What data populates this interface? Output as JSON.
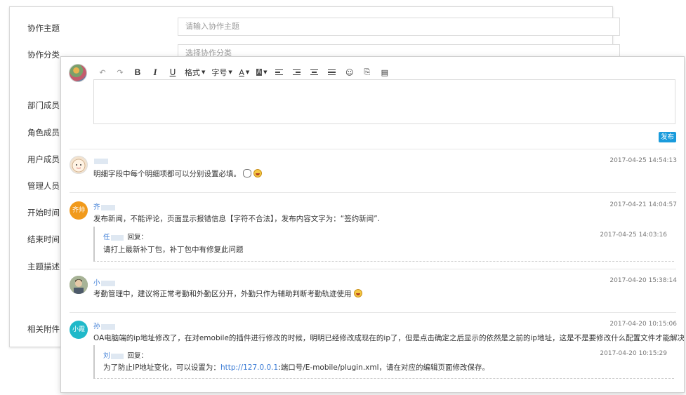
{
  "form": {
    "labels": [
      "协作主题",
      "协作分类",
      "部门成员",
      "角色成员",
      "用户成员",
      "管理人员",
      "开始时间",
      "结束时间",
      "主题描述",
      "相关附件"
    ],
    "subject_placeholder": "请输入协作主题",
    "category_placeholder": "选择协作分类"
  },
  "toolbar": {
    "format_label": "格式",
    "fontsize_label": "字号",
    "font_color_label": "A",
    "bg_color_label": "A",
    "bold_label": "B",
    "italic_label": "I",
    "underline_label": "U"
  },
  "composer": {
    "publish_label": "发布"
  },
  "comments": [
    {
      "name": "",
      "avatar_text": "",
      "avatar_color": "#f3e3cf",
      "time": "2017-04-25 14:54:13",
      "text": "明细字段中每个明细项都可以分别设置必填。",
      "emojis": [
        "chat-bubble",
        "grinning-face"
      ],
      "reply": null
    },
    {
      "name": "齐",
      "avatar_text": "齐帅",
      "avatar_color": "#f19a1c",
      "time": "2017-04-21 14:04:57",
      "text": "发布新闻，不能评论，页面显示报错信息【字符不合法】，发布内容文字为：“签约新闻”.",
      "emojis": [],
      "reply": {
        "name": "任",
        "label": "回复：",
        "time": "2017-04-25 14:03:16",
        "text": "请打上最新补丁包，补丁包中有修复此问题"
      }
    },
    {
      "name": "小",
      "avatar_text": "",
      "avatar_color": "#8a9a7a",
      "time": "2017-04-20 15:38:14",
      "text": "考勤管理中，建议将正常考勤和外勤区分开，外勤只作为辅助判断考勤轨迹使用",
      "emojis": [
        "grinning-face"
      ],
      "reply": null
    },
    {
      "name": "孙",
      "avatar_text": "小霞",
      "avatar_color": "#20b9c9",
      "time": "2017-04-20 10:15:06",
      "text": "OA电脑端的ip地址修改了，在对emobile的插件进行修改的时候，明明已经修改成现在的ip了，但是点击确定之后显示的依然是之前的ip地址，这是不是要修改什么配置文件才能解决。",
      "emojis": [],
      "reply": {
        "name": "刘",
        "label": "回复：",
        "time": "2017-04-20 10:15:29",
        "text_prefix": "为了防止IP地址变化，可以设置为：",
        "link": "http://127.0.0.1",
        "text_suffix": ":端口号/E-mobile/plugin.xml，请在对应的编辑页面修改保存。"
      }
    }
  ]
}
